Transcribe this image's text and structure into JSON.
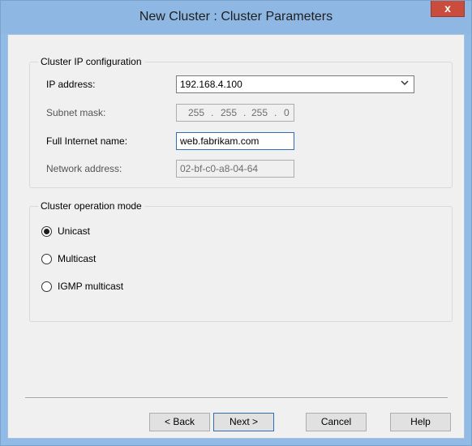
{
  "window": {
    "title": "New Cluster :  Cluster Parameters",
    "close_label": "x"
  },
  "ip_config": {
    "group_title": "Cluster IP configuration",
    "ip_address_label": "IP address:",
    "ip_address_value": "192.168.4.100",
    "subnet_mask_label": "Subnet mask:",
    "subnet_mask_octets": [
      "255",
      "255",
      "255",
      "0"
    ],
    "subnet_dot": ".",
    "full_internet_name_label": "Full Internet name:",
    "full_internet_name_value": "web.fabrikam.com",
    "network_address_label": "Network address:",
    "network_address_value": "02-bf-c0-a8-04-64"
  },
  "operation_mode": {
    "group_title": "Cluster operation mode",
    "options": [
      {
        "label": "Unicast",
        "selected": true
      },
      {
        "label": "Multicast",
        "selected": false
      },
      {
        "label": "IGMP multicast",
        "selected": false
      }
    ]
  },
  "buttons": {
    "back": "< Back",
    "next": "Next >",
    "cancel": "Cancel",
    "help": "Help"
  },
  "colors": {
    "title_bar": "#8eb8e3",
    "close_button": "#c94c3c",
    "dialog_background": "#f0f0f0",
    "focus_border": "#2f6db5"
  },
  "icons": {
    "dropdown": "chevron-down-icon"
  }
}
